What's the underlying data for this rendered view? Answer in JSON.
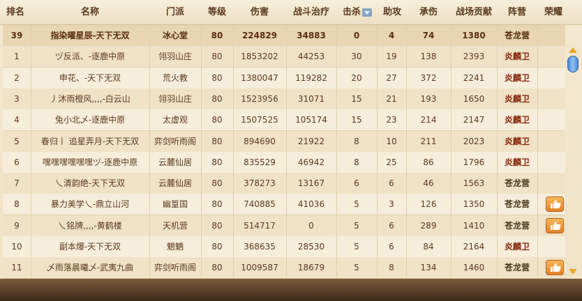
{
  "columns": {
    "rank": "排名",
    "name": "名称",
    "sect": "门派",
    "level": "等级",
    "damage": "伤害",
    "healing": "战斗治疗",
    "kills": "击杀",
    "assists": "助攻",
    "tank": "承伤",
    "contribution": "战场贡献",
    "camp": "阵营",
    "honor": "荣耀"
  },
  "colors": {
    "camp_dragon": "#4a3a1c",
    "camp_fire": "#8a2a10",
    "accent": "#e4812a"
  },
  "rows": [
    {
      "rank": "39",
      "name": "指染曜星辰-天下无双",
      "sect": "冰心堂",
      "level": "80",
      "damage": "224829",
      "healing": "34883",
      "kills": "0",
      "assists": "4",
      "tank": "74",
      "contribution": "1380",
      "camp": "苍龙营",
      "honor": false,
      "self": true
    },
    {
      "rank": "1",
      "name": "ヅ反派、-逐鹿中原",
      "sect": "翎羽山庄",
      "level": "80",
      "damage": "1853202",
      "healing": "44253",
      "kills": "30",
      "assists": "19",
      "tank": "138",
      "contribution": "2393",
      "camp": "炎麟卫",
      "honor": false
    },
    {
      "rank": "2",
      "name": "申花、-天下无双",
      "sect": "荒火教",
      "level": "80",
      "damage": "1380047",
      "healing": "119282",
      "kills": "20",
      "assists": "27",
      "tank": "372",
      "contribution": "2241",
      "camp": "炎麟卫",
      "honor": false
    },
    {
      "rank": "3",
      "name": "丿沐雨橙风,,,,-白云山",
      "sect": "翎羽山庄",
      "level": "80",
      "damage": "1523956",
      "healing": "31071",
      "kills": "15",
      "assists": "21",
      "tank": "193",
      "contribution": "1650",
      "camp": "炎麟卫",
      "honor": false
    },
    {
      "rank": "4",
      "name": "兔小北乄-逐鹿中原",
      "sect": "太虚观",
      "level": "80",
      "damage": "1507525",
      "healing": "105174",
      "kills": "15",
      "assists": "23",
      "tank": "214",
      "contribution": "2147",
      "camp": "炎麟卫",
      "honor": false
    },
    {
      "rank": "5",
      "name": "春归丨 追星弄月-天下无双",
      "sect": "弈剑听雨阁",
      "level": "80",
      "damage": "894690",
      "healing": "21922",
      "kills": "8",
      "assists": "10",
      "tank": "211",
      "contribution": "2023",
      "camp": "炎麟卫",
      "honor": false
    },
    {
      "rank": "6",
      "name": "嘿嘿嘿嘿嘿嘿ヅ-逐鹿中原",
      "sect": "云麓仙居",
      "level": "80",
      "damage": "835529",
      "healing": "46942",
      "kills": "8",
      "assists": "25",
      "tank": "86",
      "contribution": "1796",
      "camp": "炎麟卫",
      "honor": false
    },
    {
      "rank": "7",
      "name": "乀清韵绝-天下无双",
      "sect": "云麓仙居",
      "level": "80",
      "damage": "378273",
      "healing": "13167",
      "kills": "6",
      "assists": "6",
      "tank": "46",
      "contribution": "1563",
      "camp": "苍龙营",
      "honor": false
    },
    {
      "rank": "8",
      "name": "暴力美学乀-鼎立山河",
      "sect": "幽篁国",
      "level": "80",
      "damage": "740885",
      "healing": "41036",
      "kills": "5",
      "assists": "3",
      "tank": "126",
      "contribution": "1350",
      "camp": "苍龙营",
      "honor": true
    },
    {
      "rank": "9",
      "name": "乀铭牌,,,,-黄鹤楼",
      "sect": "天机营",
      "level": "80",
      "damage": "514717",
      "healing": "0",
      "kills": "5",
      "assists": "6",
      "tank": "289",
      "contribution": "1410",
      "camp": "苍龙营",
      "honor": true
    },
    {
      "rank": "10",
      "name": "副本爆-天下无双",
      "sect": "魍魉",
      "level": "80",
      "damage": "368635",
      "healing": "28530",
      "kills": "5",
      "assists": "6",
      "tank": "84",
      "contribution": "2164",
      "camp": "炎麟卫",
      "honor": false
    },
    {
      "rank": "11",
      "name": "乄雨落晨曦乄-武夷九曲",
      "sect": "弈剑听雨阁",
      "level": "80",
      "damage": "1009587",
      "healing": "18679",
      "kills": "5",
      "assists": "8",
      "tank": "134",
      "contribution": "1460",
      "camp": "苍龙营",
      "honor": true
    }
  ]
}
